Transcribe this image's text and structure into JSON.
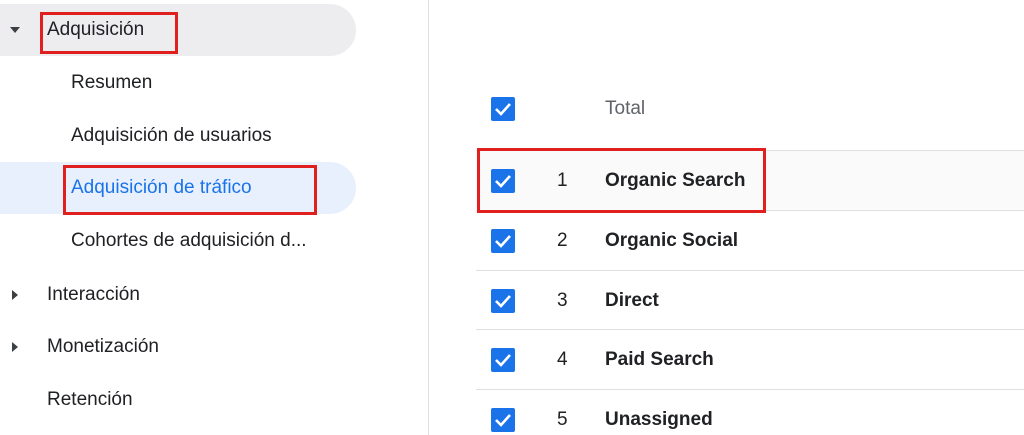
{
  "sidebar": {
    "sections": [
      {
        "label": "Adquisición",
        "expanded": true
      },
      {
        "label": "Interacción",
        "expanded": false
      },
      {
        "label": "Monetización",
        "expanded": false
      },
      {
        "label": "Retención",
        "expanded": false
      }
    ],
    "acquisition_items": [
      {
        "label": "Resumen",
        "active": false
      },
      {
        "label": "Adquisición de usuarios",
        "active": false
      },
      {
        "label": "Adquisición de tráfico",
        "active": true
      },
      {
        "label": "Cohortes de adquisición d...",
        "active": false
      }
    ]
  },
  "table": {
    "header": {
      "label": "Total",
      "checked": true
    },
    "rows": [
      {
        "index": "1",
        "source": "Organic Search",
        "checked": true
      },
      {
        "index": "2",
        "source": "Organic Social",
        "checked": true
      },
      {
        "index": "3",
        "source": "Direct",
        "checked": true
      },
      {
        "index": "4",
        "source": "Paid Search",
        "checked": true
      },
      {
        "index": "5",
        "source": "Unassigned",
        "checked": true
      }
    ]
  },
  "colors": {
    "accent": "#1a73e8",
    "highlight_box": "#e0201f",
    "active_bg": "#e8f0fe",
    "expanded_bg": "#ededef"
  }
}
